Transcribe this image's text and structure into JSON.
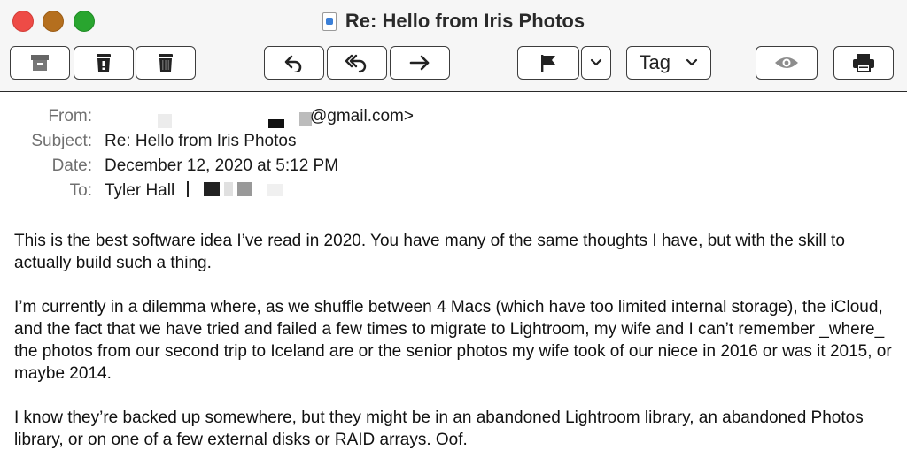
{
  "window": {
    "title": "Re: Hello from Iris Photos"
  },
  "toolbar": {
    "archive_icon": "archive-icon",
    "junk_icon": "junk-icon",
    "trash_icon": "trash-icon",
    "reply_icon": "reply-icon",
    "reply_all_icon": "reply-all-icon",
    "forward_icon": "forward-icon",
    "flag_icon": "flag-icon",
    "flag_menu_icon": "chevron-down-icon",
    "tag_label": "Tag",
    "hide_icon": "eye-icon",
    "print_icon": "printer-icon"
  },
  "header": {
    "from_label": "From:",
    "from_value": "@gmail.com>",
    "subject_label": "Subject:",
    "subject_value": "Re: Hello from Iris Photos",
    "date_label": "Date:",
    "date_value": "December 12, 2020 at 5:12 PM",
    "to_label": "To:",
    "to_value": "Tyler Hall"
  },
  "body": {
    "paragraphs": [
      "This is the best software idea I’ve read in 2020.  You have many of the same thoughts I have, but with the skill to actually build such a thing.",
      "I’m currently in a dilemma where, as we shuffle between 4 Macs (which have too limited internal storage), the iCloud, and the fact that we have tried and failed a few times to migrate to Lightroom, my wife and I can’t remember _where_ the photos from our second trip to Iceland are or the senior photos my wife took of our niece in 2016 or was it 2015, or maybe 2014.",
      "I know they’re backed up somewhere, but they might be in an abandoned Lightroom library, an abandoned Photos library, or on one of a few external disks or RAID arrays.  Oof."
    ]
  },
  "colors": {
    "close": "#ee4b46",
    "minimize": "#b56f1e",
    "zoom": "#29a52f",
    "label_text": "#707070"
  }
}
